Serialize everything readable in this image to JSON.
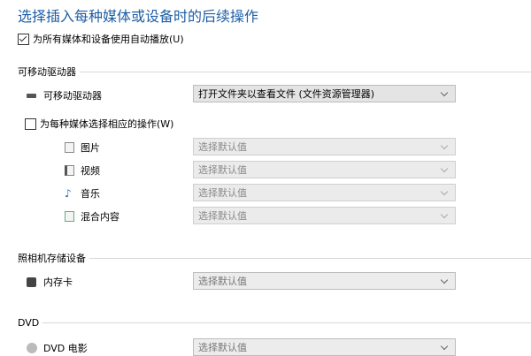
{
  "title": "选择插入每种媒体或设备时的后续操作",
  "autoplay_all": {
    "label": "为所有媒体和设备使用自动播放(U)",
    "checked": true
  },
  "removable": {
    "section": "可移动驱动器",
    "device_label": "可移动驱动器",
    "device_value": "打开文件夹以查看文件 (文件资源管理器)",
    "per_media": {
      "label": "为每种媒体选择相应的操作(W)",
      "checked": false
    },
    "media": [
      {
        "label": "图片",
        "icon": "picture-file-icon",
        "value": "选择默认值"
      },
      {
        "label": "视频",
        "icon": "video-file-icon",
        "value": "选择默认值"
      },
      {
        "label": "音乐",
        "icon": "music-note-icon",
        "value": "选择默认值"
      },
      {
        "label": "混合内容",
        "icon": "mixed-content-icon",
        "value": "选择默认值"
      }
    ]
  },
  "camera": {
    "section": "照相机存储设备",
    "label": "内存卡",
    "value": "选择默认值"
  },
  "dvd": {
    "section": "DVD",
    "label": "DVD 电影",
    "value": "选择默认值"
  }
}
